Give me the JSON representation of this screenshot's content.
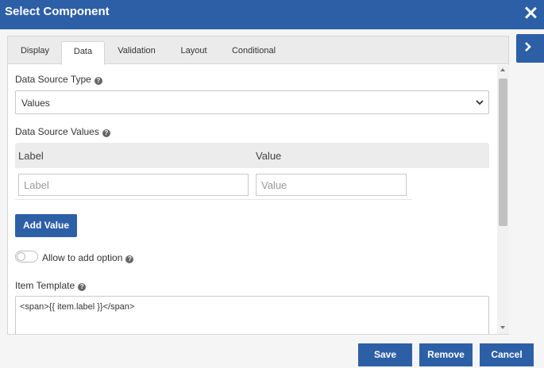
{
  "dialog": {
    "title": "Select Component"
  },
  "tabs": [
    {
      "label": "Display"
    },
    {
      "label": "Data"
    },
    {
      "label": "Validation"
    },
    {
      "label": "Layout"
    },
    {
      "label": "Conditional"
    }
  ],
  "active_tab": "Data",
  "form": {
    "data_source_type": {
      "label": "Data Source Type",
      "value": "Values"
    },
    "data_source_values": {
      "label": "Data Source Values",
      "columns": [
        "Label",
        "Value"
      ],
      "row": {
        "label_placeholder": "Label",
        "value_placeholder": "Value"
      }
    },
    "add_value_label": "Add Value",
    "allow_add_option": {
      "label": "Allow to add option",
      "checked": false
    },
    "item_template": {
      "label": "Item Template",
      "value": "<span>{{ item.label }}</span>"
    }
  },
  "footer": {
    "save": "Save",
    "remove": "Remove",
    "cancel": "Cancel"
  },
  "colors": {
    "primary": "#2d5fa7",
    "tab_bar": "#ebebeb"
  },
  "icons": {
    "close": "close-icon",
    "help": "question-circle-icon",
    "chevron": "chevron-down-icon",
    "side": "chevron-right-icon"
  }
}
